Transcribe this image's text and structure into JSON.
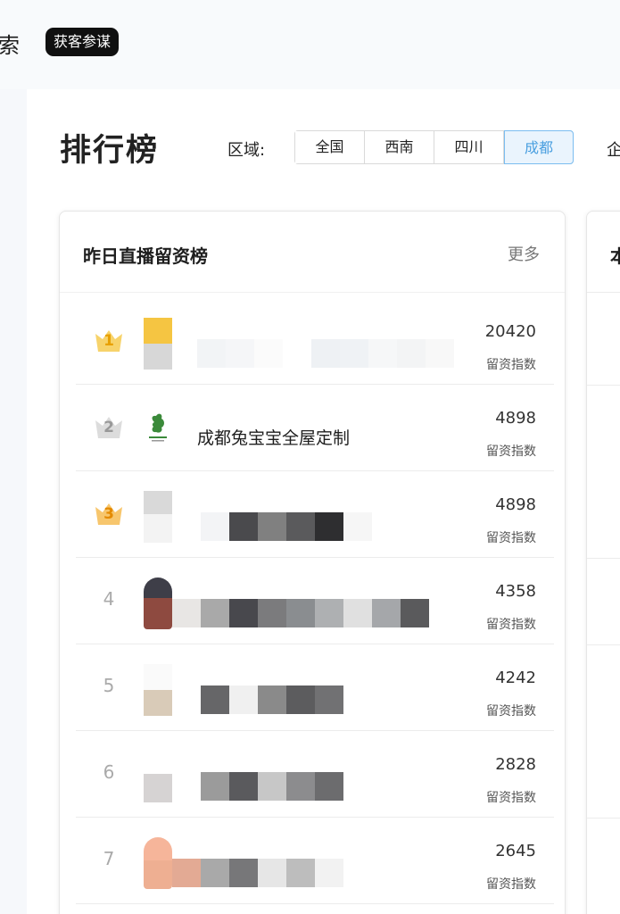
{
  "header": {
    "title_fragment": "索",
    "tag": "获客参谋"
  },
  "page_title": "排行榜",
  "region": {
    "label": "区域:",
    "tabs": [
      "全国",
      "西南",
      "四川",
      "成都"
    ],
    "active": "成都",
    "next_filter_fragment": "企"
  },
  "panel": {
    "title": "昨日直播留资榜",
    "more": "更多",
    "rows": [
      {
        "rank": "1",
        "name": "",
        "value": "20420",
        "metric": "留资指数"
      },
      {
        "rank": "2",
        "name": "成都兔宝宝全屋定制",
        "value": "4898",
        "metric": "留资指数"
      },
      {
        "rank": "3",
        "name": "",
        "value": "4898",
        "metric": "留资指数"
      },
      {
        "rank": "4",
        "name": "",
        "value": "4358",
        "metric": "留资指数"
      },
      {
        "rank": "5",
        "name": "",
        "value": "4242",
        "metric": "留资指数"
      },
      {
        "rank": "6",
        "name": "",
        "value": "2828",
        "metric": "留资指数"
      },
      {
        "rank": "7",
        "name": "",
        "value": "2645",
        "metric": "留资指数"
      }
    ]
  },
  "second_panel": {
    "title_fragment": "本"
  },
  "colors": {
    "active_tab_text": "#4a9fe0",
    "active_tab_bg": "#eaf4fd",
    "gold": "#f5c542",
    "silver": "#d0d0d0",
    "bronze": "#f3b34b"
  }
}
